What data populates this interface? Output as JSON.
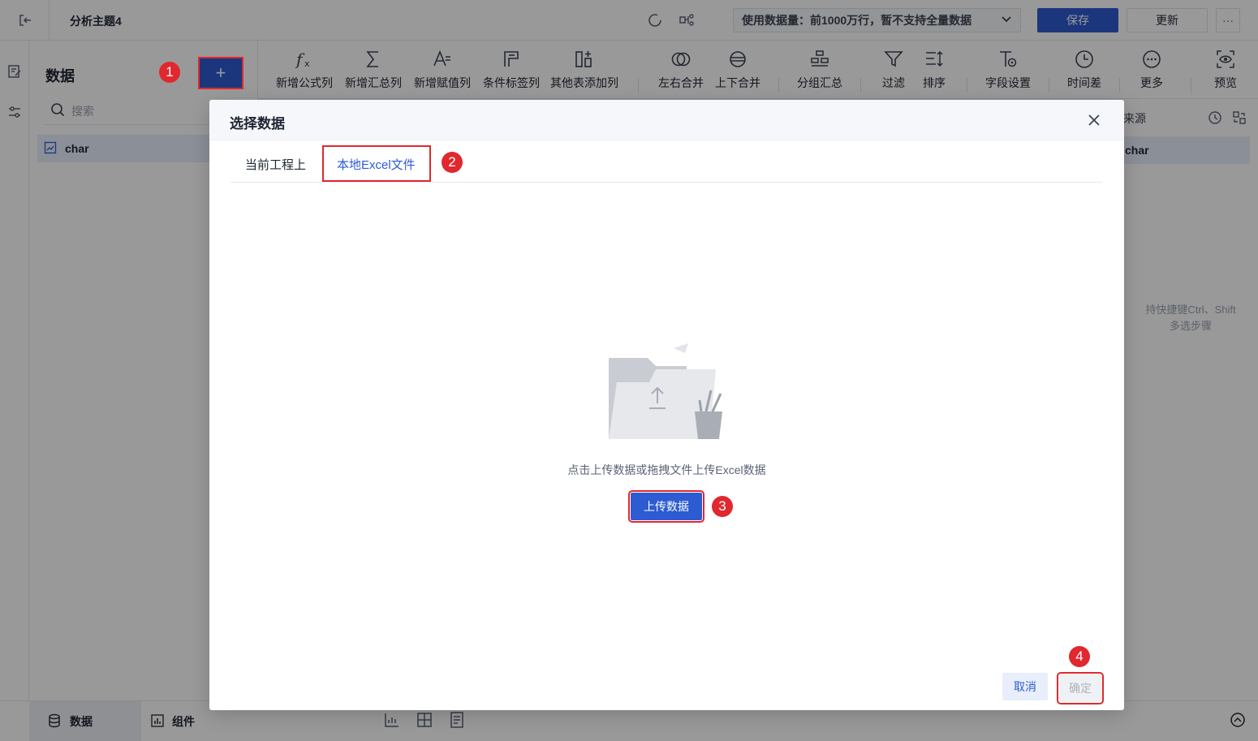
{
  "topbar": {
    "title": "分析主题4",
    "data_select": "使用数据量：前1000万行，暂不支持全量数据",
    "save_label": "保存",
    "update_label": "更新",
    "more_label": "···"
  },
  "data_panel": {
    "title": "数据",
    "add_label": "+",
    "search_placeholder": "搜索",
    "items": [
      {
        "label": "char"
      }
    ]
  },
  "toolbar": {
    "tools": [
      {
        "label": "新增公式列",
        "icon": "formula-icon"
      },
      {
        "label": "新增汇总列",
        "icon": "sigma-icon"
      },
      {
        "label": "新增赋值列",
        "icon": "assign-icon"
      },
      {
        "label": "条件标签列",
        "icon": "tag-icon"
      },
      {
        "label": "其他表添加列",
        "icon": "add-column-icon"
      },
      {
        "label": "左右合并",
        "icon": "merge-horizontal-icon"
      },
      {
        "label": "上下合并",
        "icon": "merge-vertical-icon"
      },
      {
        "label": "分组汇总",
        "icon": "group-icon"
      },
      {
        "label": "过滤",
        "icon": "filter-icon"
      },
      {
        "label": "排序",
        "icon": "sort-icon"
      },
      {
        "label": "字段设置",
        "icon": "field-settings-icon"
      },
      {
        "label": "时间差",
        "icon": "clock-icon"
      },
      {
        "label": "更多",
        "icon": "more-icon"
      },
      {
        "label": "预览",
        "icon": "preview-icon"
      }
    ]
  },
  "right_panel": {
    "header": "来源",
    "item": "char",
    "hint_line1": "持快捷键Ctrl、Shift",
    "hint_line2": "多选步骤"
  },
  "bottombar": {
    "tab_data": "数据",
    "tab_component": "组件"
  },
  "dialog": {
    "title": "选择数据",
    "tabs": [
      {
        "label": "当前工程上",
        "active": false
      },
      {
        "label": "本地Excel文件",
        "active": true
      }
    ],
    "empty_text": "点击上传数据或拖拽文件上传Excel数据",
    "upload_label": "上传数据",
    "cancel_label": "取消",
    "ok_label": "确定"
  },
  "annotations": {
    "badge1": "1",
    "badge2": "2",
    "badge3": "3",
    "badge4": "4"
  },
  "colors": {
    "accent": "#2d5bd1",
    "annotation_red": "#e0282e"
  }
}
